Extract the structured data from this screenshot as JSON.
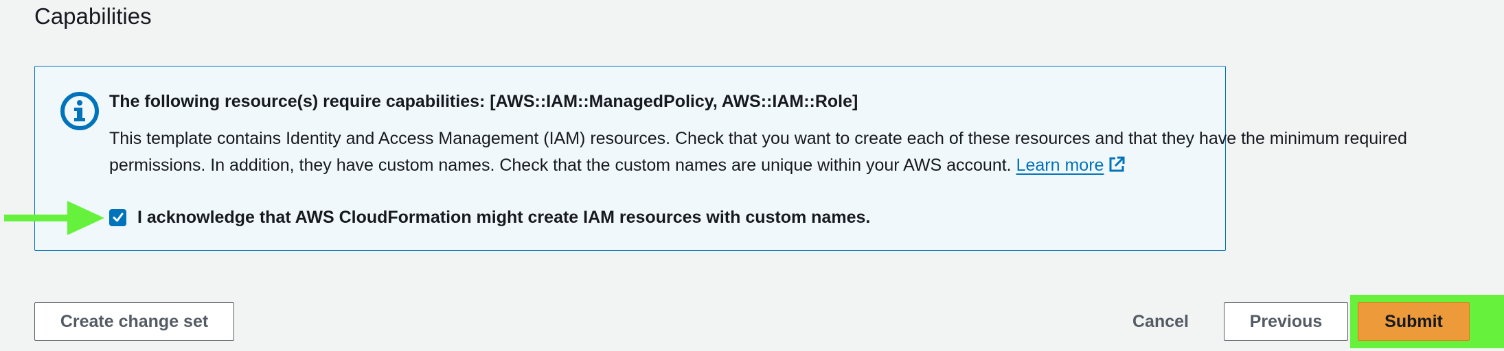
{
  "section": {
    "title": "Capabilities"
  },
  "info": {
    "icon": "info-icon",
    "heading": "The following resource(s) require capabilities: [AWS::IAM::ManagedPolicy, AWS::IAM::Role]",
    "body": "This template contains Identity and Access Management (IAM) resources. Check that you want to create each of these resources and that they have the minimum required permissions. In addition, they have custom names. Check that the custom names are unique within your AWS account.",
    "learn_more": "Learn more",
    "learn_more_icon": "external-link-icon"
  },
  "acknowledge": {
    "checked": true,
    "label": "I acknowledge that AWS CloudFormation might create IAM resources with custom names."
  },
  "annotation": {
    "arrow_color": "#66f23c",
    "highlight_color": "#66f23c"
  },
  "actions": {
    "create_change_set": "Create change set",
    "cancel": "Cancel",
    "previous": "Previous",
    "submit": "Submit"
  },
  "colors": {
    "info_border": "#0073bb",
    "info_background": "#f1f8fc",
    "link": "#0073bb",
    "primary_button": "#ec9a3a",
    "page_background": "#f2f3f3"
  }
}
